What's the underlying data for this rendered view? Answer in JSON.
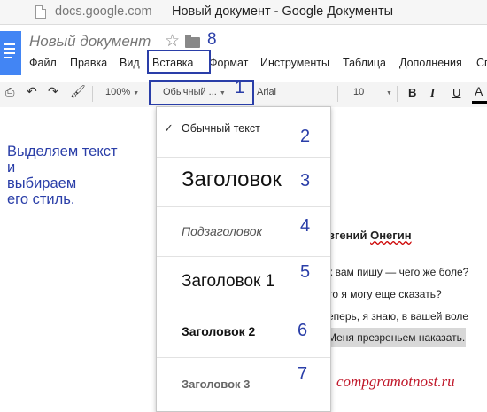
{
  "browser": {
    "domain": "docs.google.com",
    "tab_title": "Новый документ - Google Документы"
  },
  "doc": {
    "title": "Новый документ",
    "star_icon": "star-icon",
    "folder_icon": "folder-icon"
  },
  "menu": {
    "items": [
      "Файл",
      "Правка",
      "Вид",
      "Вставка",
      "Формат",
      "Инструменты",
      "Таблица",
      "Дополнения",
      "Сп"
    ]
  },
  "toolbar": {
    "zoom": "100%",
    "style": "Обычный ...",
    "font": "Arial",
    "size": "10",
    "bold": "B",
    "italic": "I",
    "underline": "U",
    "text_color": "A",
    "text_color_value": "#000000"
  },
  "dropdown": {
    "items": [
      {
        "label": "Обычный текст",
        "checked": true
      },
      {
        "label": "Заголовок"
      },
      {
        "label": "Подзаголовок"
      },
      {
        "label": "Заголовок 1"
      },
      {
        "label": "Заголовок 2"
      },
      {
        "label": "Заголовок 3"
      }
    ]
  },
  "annotations": {
    "numbers": [
      "1",
      "2",
      "3",
      "4",
      "5",
      "6",
      "7",
      "8"
    ],
    "note_lines": [
      "Выделяем текст",
      "и",
      "выбираем",
      "его стиль."
    ],
    "color": "#2a3ea8"
  },
  "document_text": {
    "heading_prefix": "вгений ",
    "heading_underlined": "Онегин",
    "lines": [
      "к вам пишу — чего же боле?",
      "то я могу еще сказать?",
      "еперь, я знаю, в вашей воле",
      "Меня презреньем наказать."
    ]
  },
  "watermark": "compgramotnost.ru"
}
